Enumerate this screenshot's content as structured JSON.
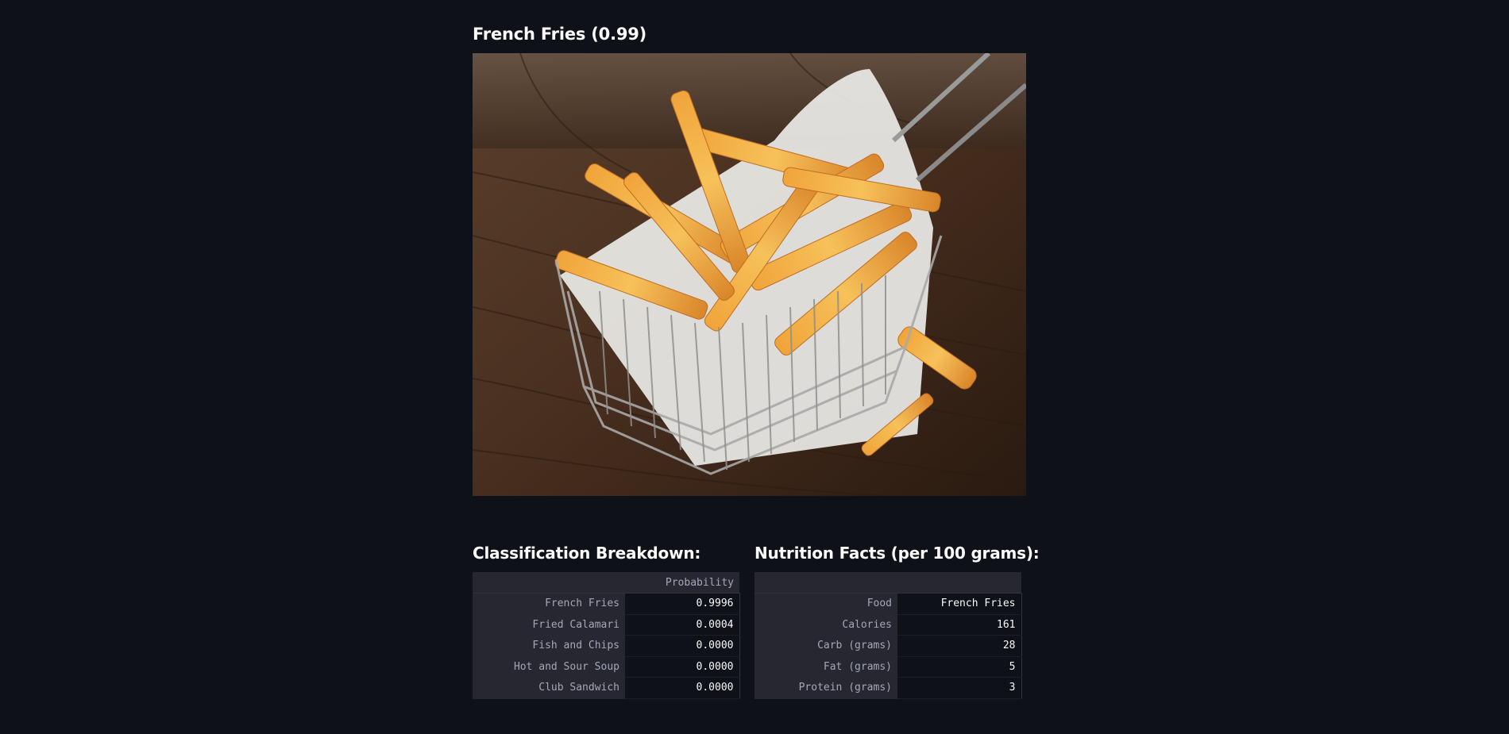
{
  "prediction": {
    "title": "French Fries (0.99)"
  },
  "image": {
    "subject": "french-fries-in-wire-basket"
  },
  "classification": {
    "heading": "Classification Breakdown:",
    "column_header": "Probability",
    "rows": [
      {
        "label": "French Fries",
        "value": "0.9996"
      },
      {
        "label": "Fried Calamari",
        "value": "0.0004"
      },
      {
        "label": "Fish and Chips",
        "value": "0.0000"
      },
      {
        "label": "Hot and Sour Soup",
        "value": "0.0000"
      },
      {
        "label": "Club Sandwich",
        "value": "0.0000"
      }
    ]
  },
  "nutrition": {
    "heading": "Nutrition Facts (per 100 grams):",
    "column_header": "",
    "rows": [
      {
        "label": "Food",
        "value": "French Fries"
      },
      {
        "label": "Calories",
        "value": "161"
      },
      {
        "label": "Carb (grams)",
        "value": "28"
      },
      {
        "label": "Fat (grams)",
        "value": "5"
      },
      {
        "label": "Protein (grams)",
        "value": "3"
      }
    ]
  },
  "colors": {
    "background": "#0e1117",
    "text": "#fafafa",
    "table_header_bg": "#262730",
    "table_header_text": "#a3a8b8"
  }
}
